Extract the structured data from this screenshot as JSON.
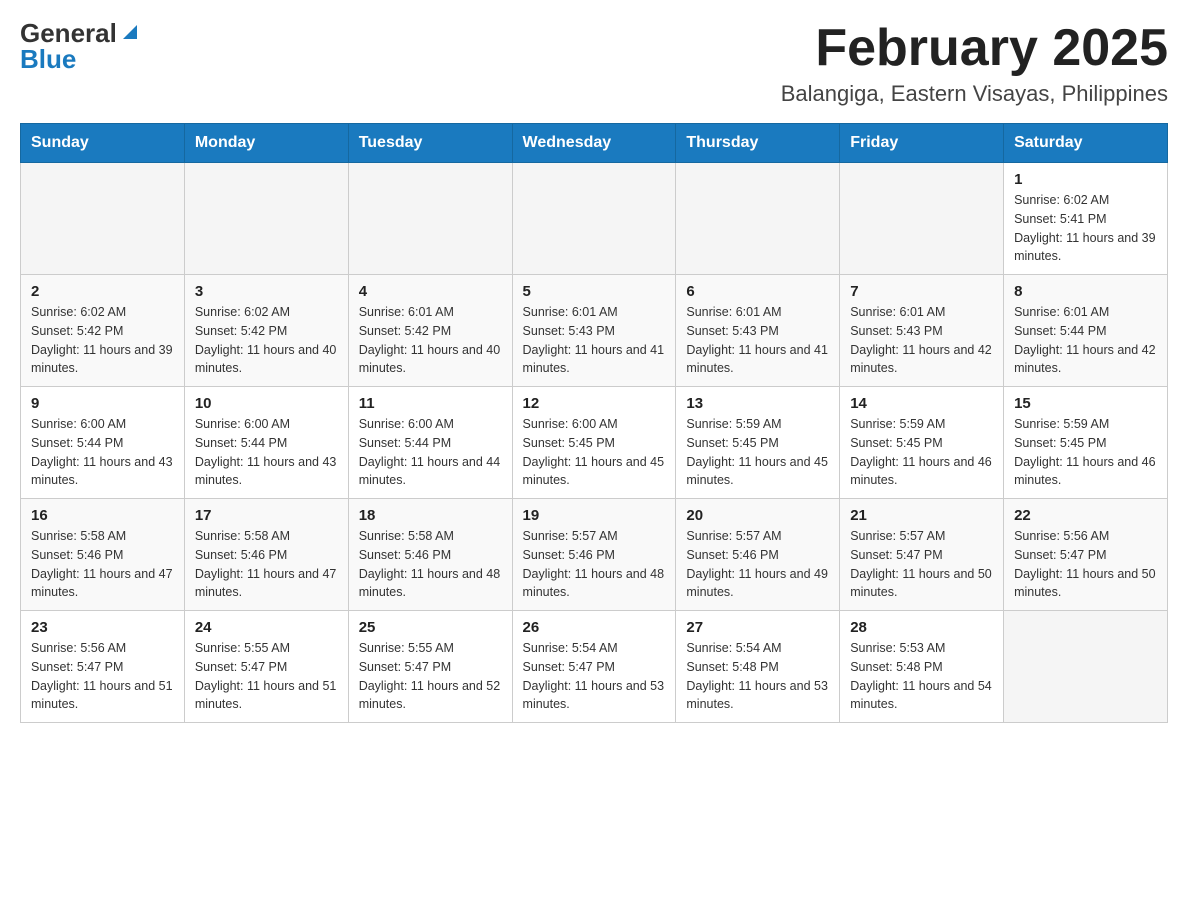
{
  "header": {
    "logo_general": "General",
    "logo_blue": "Blue",
    "month_title": "February 2025",
    "location": "Balangiga, Eastern Visayas, Philippines"
  },
  "days_of_week": [
    "Sunday",
    "Monday",
    "Tuesday",
    "Wednesday",
    "Thursday",
    "Friday",
    "Saturday"
  ],
  "weeks": [
    [
      {
        "day": "",
        "sunrise": "",
        "sunset": "",
        "daylight": ""
      },
      {
        "day": "",
        "sunrise": "",
        "sunset": "",
        "daylight": ""
      },
      {
        "day": "",
        "sunrise": "",
        "sunset": "",
        "daylight": ""
      },
      {
        "day": "",
        "sunrise": "",
        "sunset": "",
        "daylight": ""
      },
      {
        "day": "",
        "sunrise": "",
        "sunset": "",
        "daylight": ""
      },
      {
        "day": "",
        "sunrise": "",
        "sunset": "",
        "daylight": ""
      },
      {
        "day": "1",
        "sunrise": "Sunrise: 6:02 AM",
        "sunset": "Sunset: 5:41 PM",
        "daylight": "Daylight: 11 hours and 39 minutes."
      }
    ],
    [
      {
        "day": "2",
        "sunrise": "Sunrise: 6:02 AM",
        "sunset": "Sunset: 5:42 PM",
        "daylight": "Daylight: 11 hours and 39 minutes."
      },
      {
        "day": "3",
        "sunrise": "Sunrise: 6:02 AM",
        "sunset": "Sunset: 5:42 PM",
        "daylight": "Daylight: 11 hours and 40 minutes."
      },
      {
        "day": "4",
        "sunrise": "Sunrise: 6:01 AM",
        "sunset": "Sunset: 5:42 PM",
        "daylight": "Daylight: 11 hours and 40 minutes."
      },
      {
        "day": "5",
        "sunrise": "Sunrise: 6:01 AM",
        "sunset": "Sunset: 5:43 PM",
        "daylight": "Daylight: 11 hours and 41 minutes."
      },
      {
        "day": "6",
        "sunrise": "Sunrise: 6:01 AM",
        "sunset": "Sunset: 5:43 PM",
        "daylight": "Daylight: 11 hours and 41 minutes."
      },
      {
        "day": "7",
        "sunrise": "Sunrise: 6:01 AM",
        "sunset": "Sunset: 5:43 PM",
        "daylight": "Daylight: 11 hours and 42 minutes."
      },
      {
        "day": "8",
        "sunrise": "Sunrise: 6:01 AM",
        "sunset": "Sunset: 5:44 PM",
        "daylight": "Daylight: 11 hours and 42 minutes."
      }
    ],
    [
      {
        "day": "9",
        "sunrise": "Sunrise: 6:00 AM",
        "sunset": "Sunset: 5:44 PM",
        "daylight": "Daylight: 11 hours and 43 minutes."
      },
      {
        "day": "10",
        "sunrise": "Sunrise: 6:00 AM",
        "sunset": "Sunset: 5:44 PM",
        "daylight": "Daylight: 11 hours and 43 minutes."
      },
      {
        "day": "11",
        "sunrise": "Sunrise: 6:00 AM",
        "sunset": "Sunset: 5:44 PM",
        "daylight": "Daylight: 11 hours and 44 minutes."
      },
      {
        "day": "12",
        "sunrise": "Sunrise: 6:00 AM",
        "sunset": "Sunset: 5:45 PM",
        "daylight": "Daylight: 11 hours and 45 minutes."
      },
      {
        "day": "13",
        "sunrise": "Sunrise: 5:59 AM",
        "sunset": "Sunset: 5:45 PM",
        "daylight": "Daylight: 11 hours and 45 minutes."
      },
      {
        "day": "14",
        "sunrise": "Sunrise: 5:59 AM",
        "sunset": "Sunset: 5:45 PM",
        "daylight": "Daylight: 11 hours and 46 minutes."
      },
      {
        "day": "15",
        "sunrise": "Sunrise: 5:59 AM",
        "sunset": "Sunset: 5:45 PM",
        "daylight": "Daylight: 11 hours and 46 minutes."
      }
    ],
    [
      {
        "day": "16",
        "sunrise": "Sunrise: 5:58 AM",
        "sunset": "Sunset: 5:46 PM",
        "daylight": "Daylight: 11 hours and 47 minutes."
      },
      {
        "day": "17",
        "sunrise": "Sunrise: 5:58 AM",
        "sunset": "Sunset: 5:46 PM",
        "daylight": "Daylight: 11 hours and 47 minutes."
      },
      {
        "day": "18",
        "sunrise": "Sunrise: 5:58 AM",
        "sunset": "Sunset: 5:46 PM",
        "daylight": "Daylight: 11 hours and 48 minutes."
      },
      {
        "day": "19",
        "sunrise": "Sunrise: 5:57 AM",
        "sunset": "Sunset: 5:46 PM",
        "daylight": "Daylight: 11 hours and 48 minutes."
      },
      {
        "day": "20",
        "sunrise": "Sunrise: 5:57 AM",
        "sunset": "Sunset: 5:46 PM",
        "daylight": "Daylight: 11 hours and 49 minutes."
      },
      {
        "day": "21",
        "sunrise": "Sunrise: 5:57 AM",
        "sunset": "Sunset: 5:47 PM",
        "daylight": "Daylight: 11 hours and 50 minutes."
      },
      {
        "day": "22",
        "sunrise": "Sunrise: 5:56 AM",
        "sunset": "Sunset: 5:47 PM",
        "daylight": "Daylight: 11 hours and 50 minutes."
      }
    ],
    [
      {
        "day": "23",
        "sunrise": "Sunrise: 5:56 AM",
        "sunset": "Sunset: 5:47 PM",
        "daylight": "Daylight: 11 hours and 51 minutes."
      },
      {
        "day": "24",
        "sunrise": "Sunrise: 5:55 AM",
        "sunset": "Sunset: 5:47 PM",
        "daylight": "Daylight: 11 hours and 51 minutes."
      },
      {
        "day": "25",
        "sunrise": "Sunrise: 5:55 AM",
        "sunset": "Sunset: 5:47 PM",
        "daylight": "Daylight: 11 hours and 52 minutes."
      },
      {
        "day": "26",
        "sunrise": "Sunrise: 5:54 AM",
        "sunset": "Sunset: 5:47 PM",
        "daylight": "Daylight: 11 hours and 53 minutes."
      },
      {
        "day": "27",
        "sunrise": "Sunrise: 5:54 AM",
        "sunset": "Sunset: 5:48 PM",
        "daylight": "Daylight: 11 hours and 53 minutes."
      },
      {
        "day": "28",
        "sunrise": "Sunrise: 5:53 AM",
        "sunset": "Sunset: 5:48 PM",
        "daylight": "Daylight: 11 hours and 54 minutes."
      },
      {
        "day": "",
        "sunrise": "",
        "sunset": "",
        "daylight": ""
      }
    ]
  ]
}
